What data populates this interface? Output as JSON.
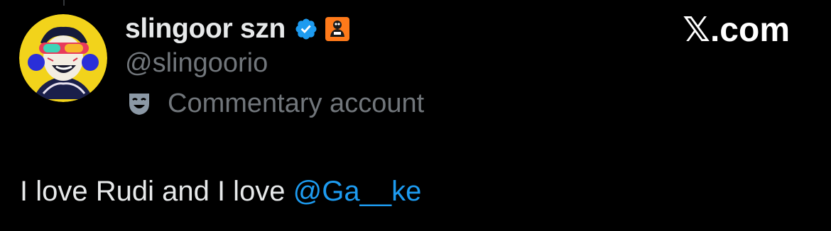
{
  "tweet": {
    "author": {
      "display_name": "slingoor szn",
      "handle": "@slingoorio",
      "verified_icon": "verified-badge-icon",
      "affiliate_icon": "affiliate-badge-icon",
      "avatar_icon": "cartoon-avatar"
    },
    "account_label": {
      "icon": "theater-mask-icon",
      "text": "Commentary account"
    },
    "brand": "𝕏.com",
    "text_prefix": "I love Rudi and I love ",
    "mention": "@Ga__ke"
  },
  "colors": {
    "background": "#000000",
    "primary_text": "#e7e9ea",
    "secondary_text": "#71767b",
    "link": "#1d9bf0",
    "verified": "#1d9bf0",
    "affiliate_bg": "#ff7a1a"
  }
}
